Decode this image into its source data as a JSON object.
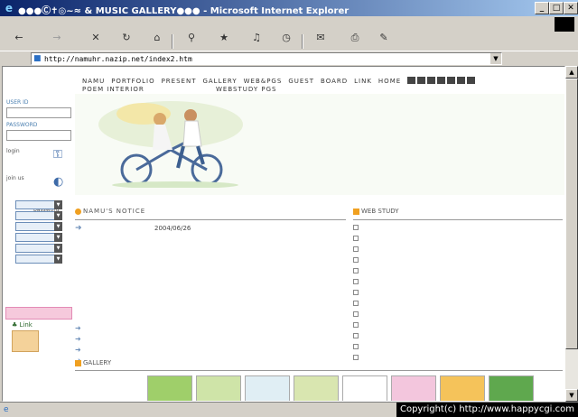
{
  "window": {
    "title": "●●●Ⓒ✝◎~≈ & MUSIC GALLERY●●● - Microsoft Internet Explorer",
    "minimize": "_",
    "maximize": "□",
    "close": "✕"
  },
  "menu": [
    "",
    "",
    "",
    "",
    "",
    ""
  ],
  "toolbar": [
    {
      "label": "",
      "icon": "←",
      "disabled": false
    },
    {
      "label": "",
      "icon": "→",
      "disabled": true
    },
    {
      "label": "",
      "icon": "✕",
      "disabled": false
    },
    {
      "label": "",
      "icon": "↻",
      "disabled": false
    },
    {
      "label": "",
      "icon": "⌂",
      "disabled": false
    },
    {
      "label": "",
      "icon": "⚲",
      "disabled": false
    },
    {
      "label": "",
      "icon": "★",
      "disabled": false
    },
    {
      "label": "",
      "icon": "♫",
      "disabled": false
    },
    {
      "label": "",
      "icon": "◷",
      "disabled": false
    },
    {
      "label": "",
      "icon": "✉",
      "disabled": false
    },
    {
      "label": "",
      "icon": "⎙",
      "disabled": false
    },
    {
      "label": "",
      "icon": "✎",
      "disabled": false
    }
  ],
  "address": {
    "label": "",
    "url": "http://namuhr.nazip.net/index2.htm",
    "go": "",
    "links": ""
  },
  "nav": {
    "row1": [
      "NAMU",
      "PORTFOLIO",
      "PRESENT",
      "GALLERY",
      "WEB&PGS",
      "GUEST",
      "BOARD",
      "LINK",
      "HOME"
    ],
    "row2a": "POEM INTERIOR",
    "row2b": "WEBSTUDY PGS",
    "slogan": ""
  },
  "login": {
    "user_label": "USER ID",
    "pass_label": "PASSWORD",
    "login_text": "login",
    "join_text": "join us",
    "lost_text": "lose password"
  },
  "hero": {
    "line1": "",
    "line2": ""
  },
  "sidebar": {
    "title1": "",
    "title2": "",
    "selects": [
      "",
      "",
      "",
      "",
      "",
      ""
    ]
  },
  "banner": "",
  "link_label": "Link",
  "notice": {
    "header": "NAMU'S NOTICE",
    "top_title": "",
    "top_date": "2004/06/26",
    "body": "",
    "items": [
      "",
      "",
      "",
      ""
    ]
  },
  "webstudy": {
    "header": "WEB STUDY",
    "items": [
      "",
      "",
      "",
      "",
      "",
      "",
      "",
      "",
      "",
      "",
      "",
      "",
      ""
    ]
  },
  "gallery": {
    "header": "GALLERY",
    "thumb_colors": [
      "#9fcf6a",
      "#cfe4a8",
      "#e0eef4",
      "#d9e6b0",
      "#ffffff",
      "#f3c6dd",
      "#f5c35a",
      "#5fa84e"
    ]
  },
  "status": {
    "text": "",
    "copyright": "Copyright(c) http://www.happycgi.com"
  }
}
